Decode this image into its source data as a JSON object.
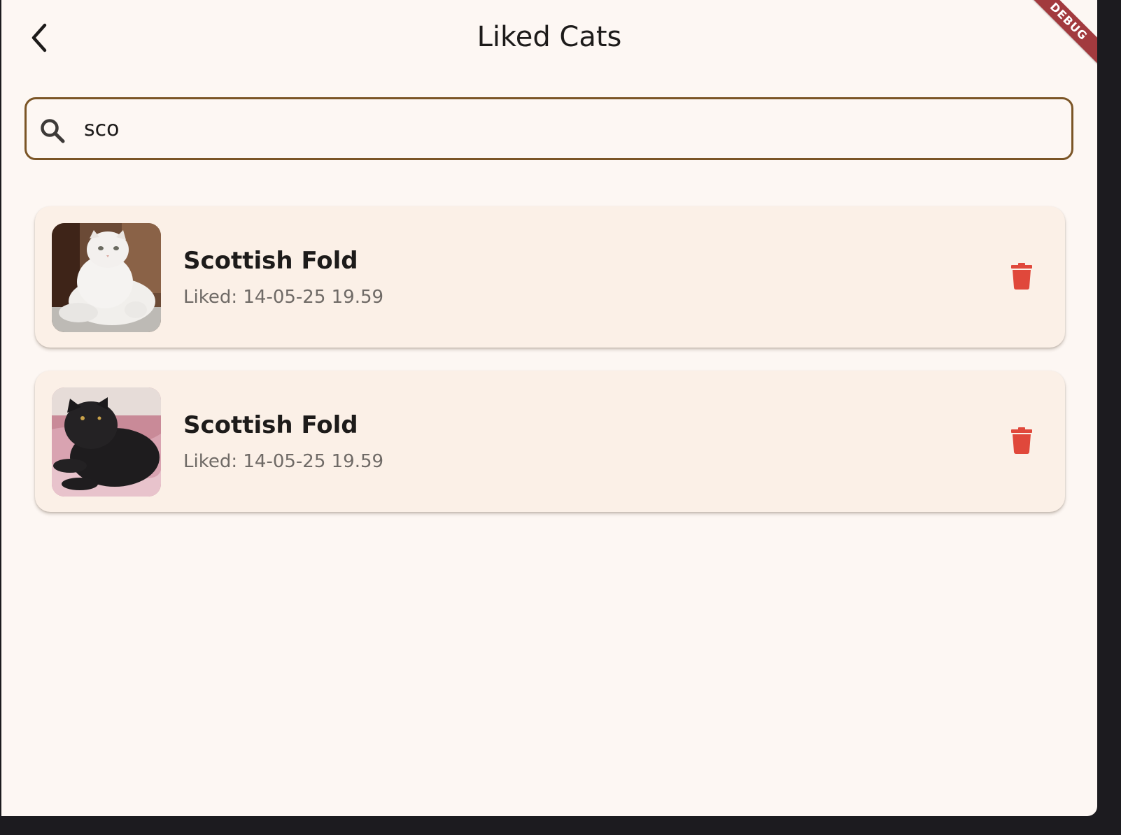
{
  "appbar": {
    "title": "Liked Cats",
    "back_icon": "chevron-left-icon",
    "debug_banner": "DEBUG"
  },
  "search": {
    "icon": "search-icon",
    "value": "sco"
  },
  "cats": [
    {
      "name": "Scottish Fold",
      "liked": "Liked: 14-05-25 19.59",
      "photo": "white scottish fold cat sitting on carpet",
      "delete_icon": "trash-icon"
    },
    {
      "name": "Scottish Fold",
      "liked": "Liked: 14-05-25 19.59",
      "photo": "black scottish fold cat lying on pink blanket",
      "delete_icon": "trash-icon"
    }
  ],
  "colors": {
    "background": "#fdf7f3",
    "card": "#fbf0e7",
    "search_border": "#7b5526",
    "delete": "#e0483b",
    "debug_banner": "#a23a3e",
    "title_text": "#1d1b1a",
    "secondary_text": "#6f6a66"
  }
}
